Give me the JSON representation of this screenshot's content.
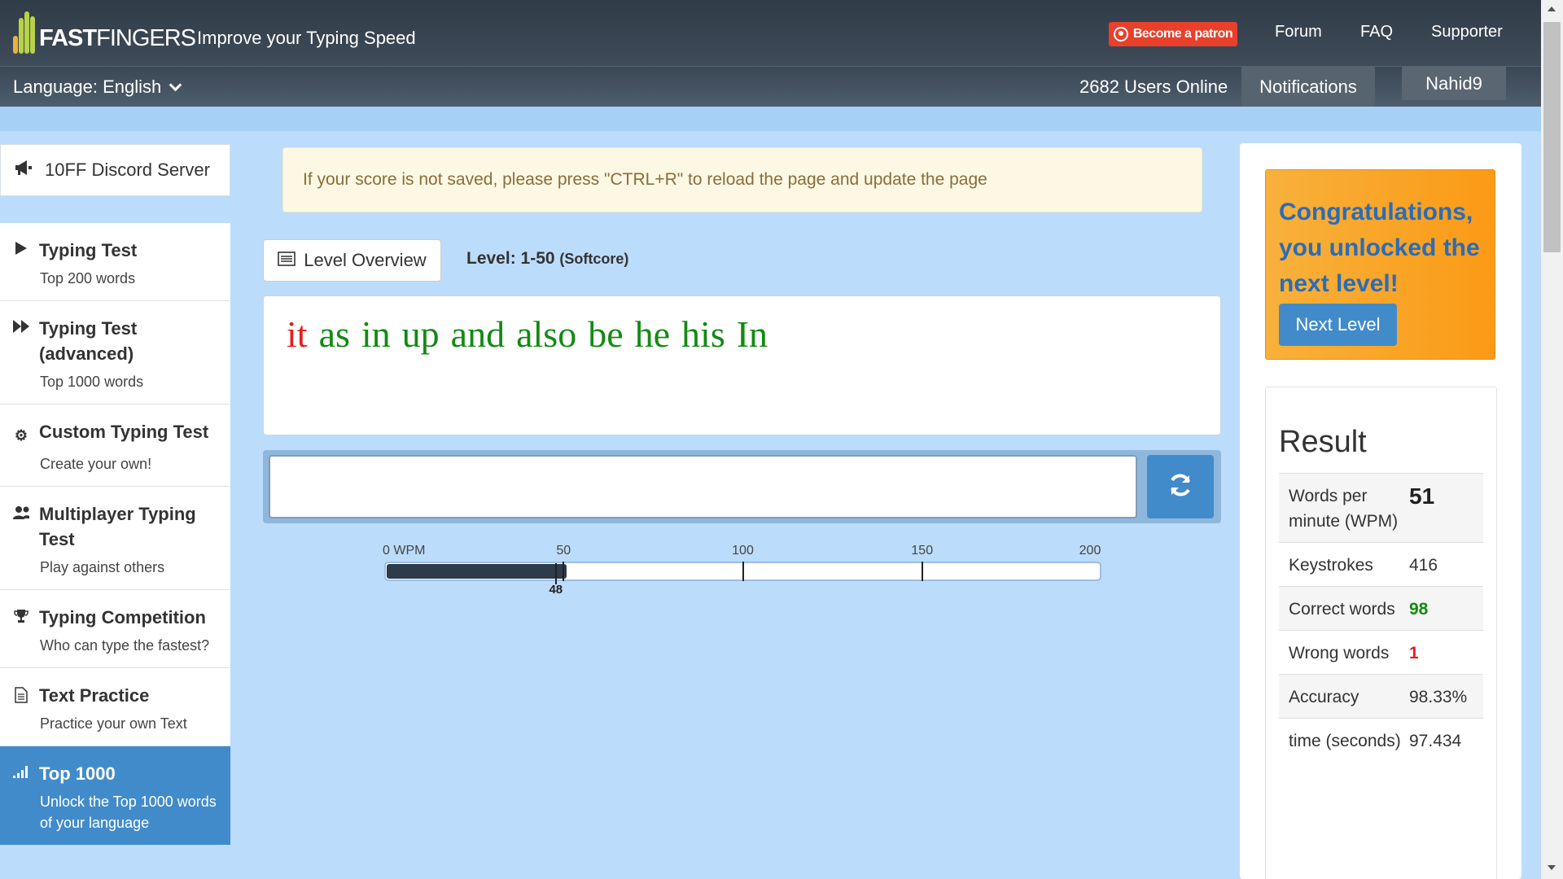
{
  "header": {
    "logo_text_a": "10",
    "logo_text_b": "FAST",
    "logo_text_c": "FINGERS",
    "tagline": "Improve your Typing Speed",
    "patron_label": "Become a patron",
    "nav": [
      "Forum",
      "FAQ",
      "Supporter"
    ]
  },
  "subheader": {
    "language_label": "Language: English",
    "users_online": "2682 Users Online",
    "notifications": "Notifications",
    "username": "Nahid9"
  },
  "sidebar": {
    "discord": "10FF Discord Server",
    "items": [
      {
        "title": "Typing Test",
        "desc": "Top 200 words",
        "icon": "play-icon"
      },
      {
        "title": "Typing Test (advanced)",
        "desc": "Top 1000 words",
        "icon": "fast-forward-icon"
      },
      {
        "title": "Custom Typing Test",
        "desc": "Create your own!",
        "icon": "cogs-icon"
      },
      {
        "title": "Multiplayer Typing Test",
        "desc": "Play against others",
        "icon": "users-icon"
      },
      {
        "title": "Typing Competition",
        "desc": "Who can type the fastest?",
        "icon": "trophy-icon"
      },
      {
        "title": "Text Practice",
        "desc": "Practice your own Text",
        "icon": "document-icon"
      },
      {
        "title": "Top 1000",
        "desc": "Unlock the Top 1000 words of your language",
        "icon": "signal-icon"
      }
    ]
  },
  "main": {
    "alert": "If your score is not saved, please press \"CTRL+R\" to reload the page and update the page",
    "level_overview": "Level Overview",
    "level_label": "Level: 1-50",
    "level_mode": "(Softcore)",
    "words": [
      {
        "text": "it",
        "color": "#e02020"
      },
      {
        "text": "as",
        "color": "#138a13"
      },
      {
        "text": "in",
        "color": "#138a13"
      },
      {
        "text": "up",
        "color": "#138a13"
      },
      {
        "text": "and",
        "color": "#138a13"
      },
      {
        "text": "also",
        "color": "#138a13"
      },
      {
        "text": "be",
        "color": "#138a13"
      },
      {
        "text": "he",
        "color": "#138a13"
      },
      {
        "text": "his",
        "color": "#138a13"
      },
      {
        "text": "In",
        "color": "#138a13"
      }
    ],
    "input_value": ""
  },
  "speed_bar": {
    "ticks": [
      "0 WPM",
      "50",
      "100",
      "150",
      "200"
    ],
    "max": 200,
    "value": 51,
    "marker_label": "48",
    "marker_value": 48
  },
  "right": {
    "congrats": "Congratulations, you unlocked the next level!",
    "next_level": "Next Level",
    "result_title": "Result",
    "rows": [
      {
        "key": "Words per minute (WPM)",
        "value": "51",
        "color": "#222",
        "bold": true
      },
      {
        "key": "Keystrokes",
        "value": "416",
        "color": "#333",
        "bold": false
      },
      {
        "key": "Correct words",
        "value": "98",
        "color": "#138a13",
        "bold": true
      },
      {
        "key": "Wrong words",
        "value": "1",
        "color": "#e02020",
        "bold": true
      },
      {
        "key": "Accuracy",
        "value": "98.33%",
        "color": "#333",
        "bold": false
      },
      {
        "key": "time (seconds)",
        "value": "97.434",
        "color": "#333",
        "bold": false
      }
    ]
  }
}
